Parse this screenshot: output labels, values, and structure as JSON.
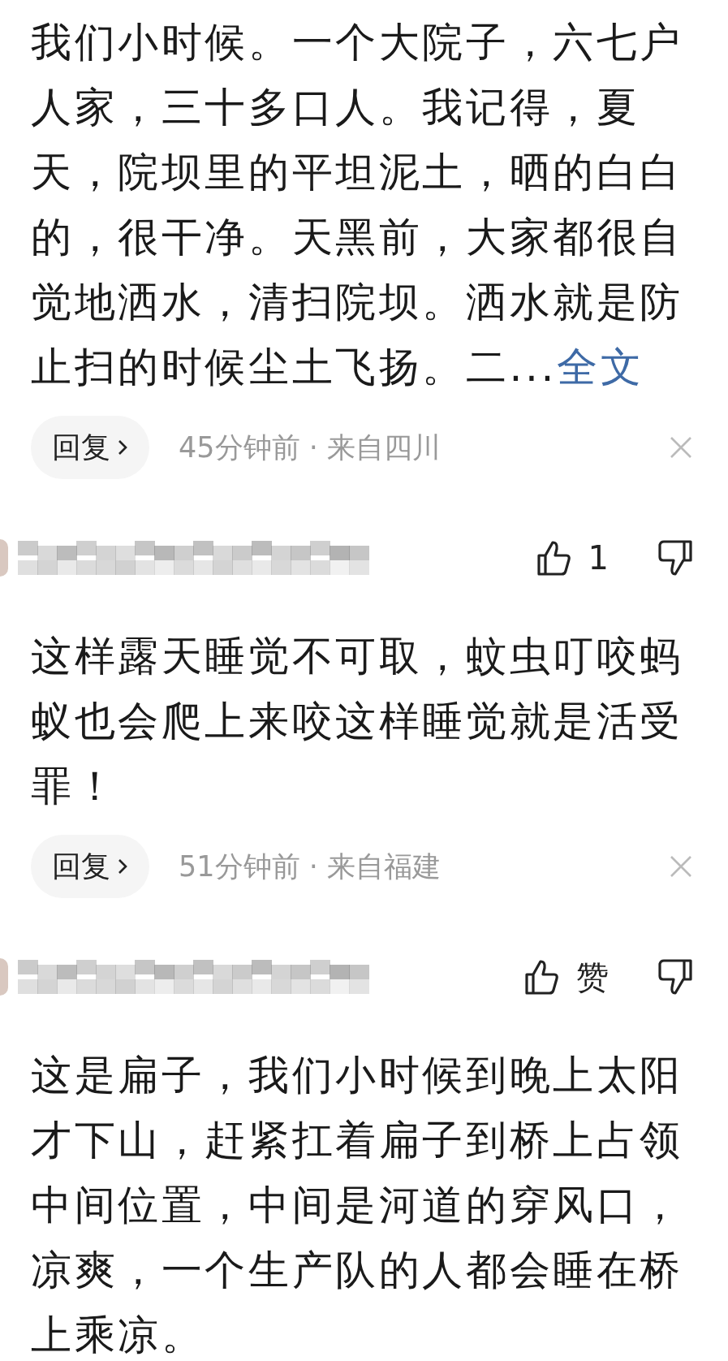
{
  "comments": [
    {
      "text": "我们小时候。一个大院子，六七户人家，三十多口人。我记得，夏天，院坝里的平坦泥土，晒的白白的，很干净。天黑前，大家都很自觉地洒水，清扫院坝。洒水就是防止扫的时候尘土飞扬。二...",
      "expand_link": "全文",
      "reply_button": "回复",
      "meta": "45分钟前 · 来自四川"
    },
    {
      "header": {
        "likes": "1"
      },
      "text": "这样露天睡觉不可取，蚊虫叮咬蚂蚁也会爬上来咬这样睡觉就是活受罪！",
      "reply_button": "回复",
      "meta": "51分钟前 · 来自福建"
    },
    {
      "header": {
        "likes": "赞"
      },
      "text": "这是扁子，我们小时候到晚上太阳才下山，赶紧扛着扁子到桥上占领中间位置，中间是河道的穿风口，凉爽，一个生产队的人都会睡在桥上乘凉。"
    }
  ]
}
